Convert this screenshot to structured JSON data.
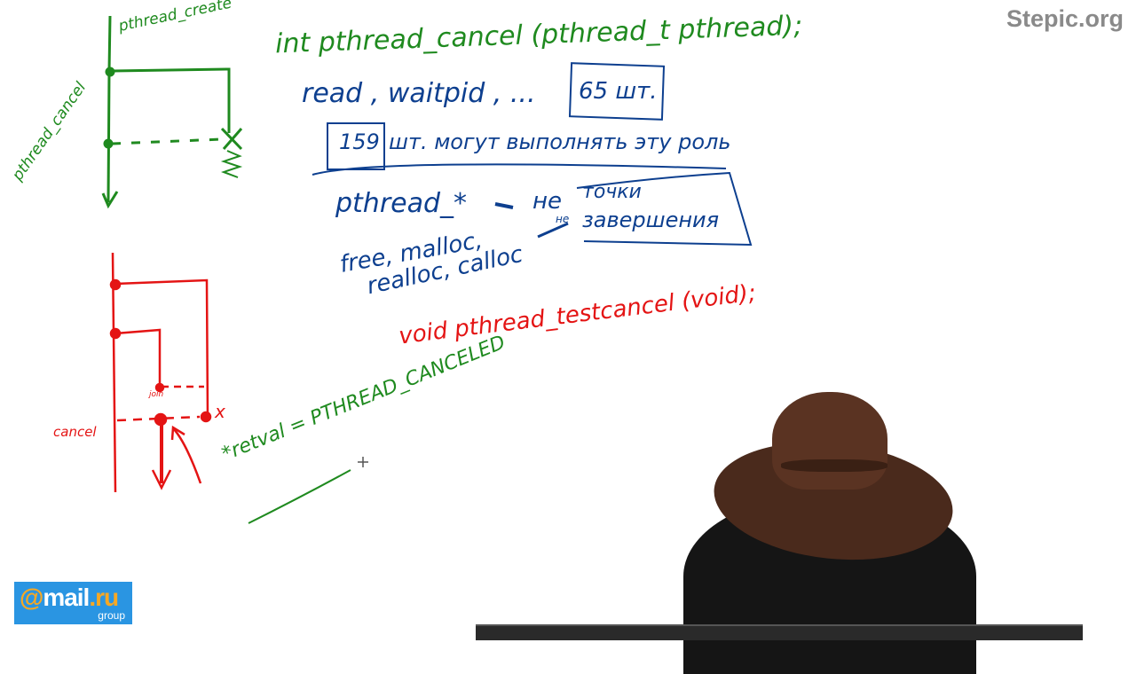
{
  "watermark": "Stepic.org",
  "logo": {
    "at": "@",
    "name": "mail",
    "dot": ".",
    "tld": "ru",
    "group": "group"
  },
  "diagram_green": {
    "label_create": "pthread_create",
    "label_cancel": "pthread_cancel"
  },
  "diagram_red": {
    "label_cancel": "cancel",
    "label_join": "join",
    "label_x": "x"
  },
  "notes": {
    "signature_cancel": "int pthread_cancel (pthread_t pthread);",
    "cancel_points": "read , waitpid , ...",
    "count_65": "65 шт.",
    "count_159": "159",
    "count_159_rest": "шт. могут выполнять эту роль",
    "pthread_star": "pthread_*",
    "arrow_ne": "не",
    "box_points": "точки",
    "box_completion": "завершения",
    "alloc_funcs_line1": "free, malloc,",
    "alloc_funcs_line2": "realloc, calloc",
    "alloc_ne": "не",
    "testcancel": "void pthread_testcancel (void);",
    "retval": "*retval = PTHREAD_CANCELED"
  },
  "colors": {
    "green": "#1f8a1f",
    "blue": "#0d3f8f",
    "red": "#e41414",
    "logo_bg": "#2a95e2",
    "logo_accent": "#f7a823"
  }
}
